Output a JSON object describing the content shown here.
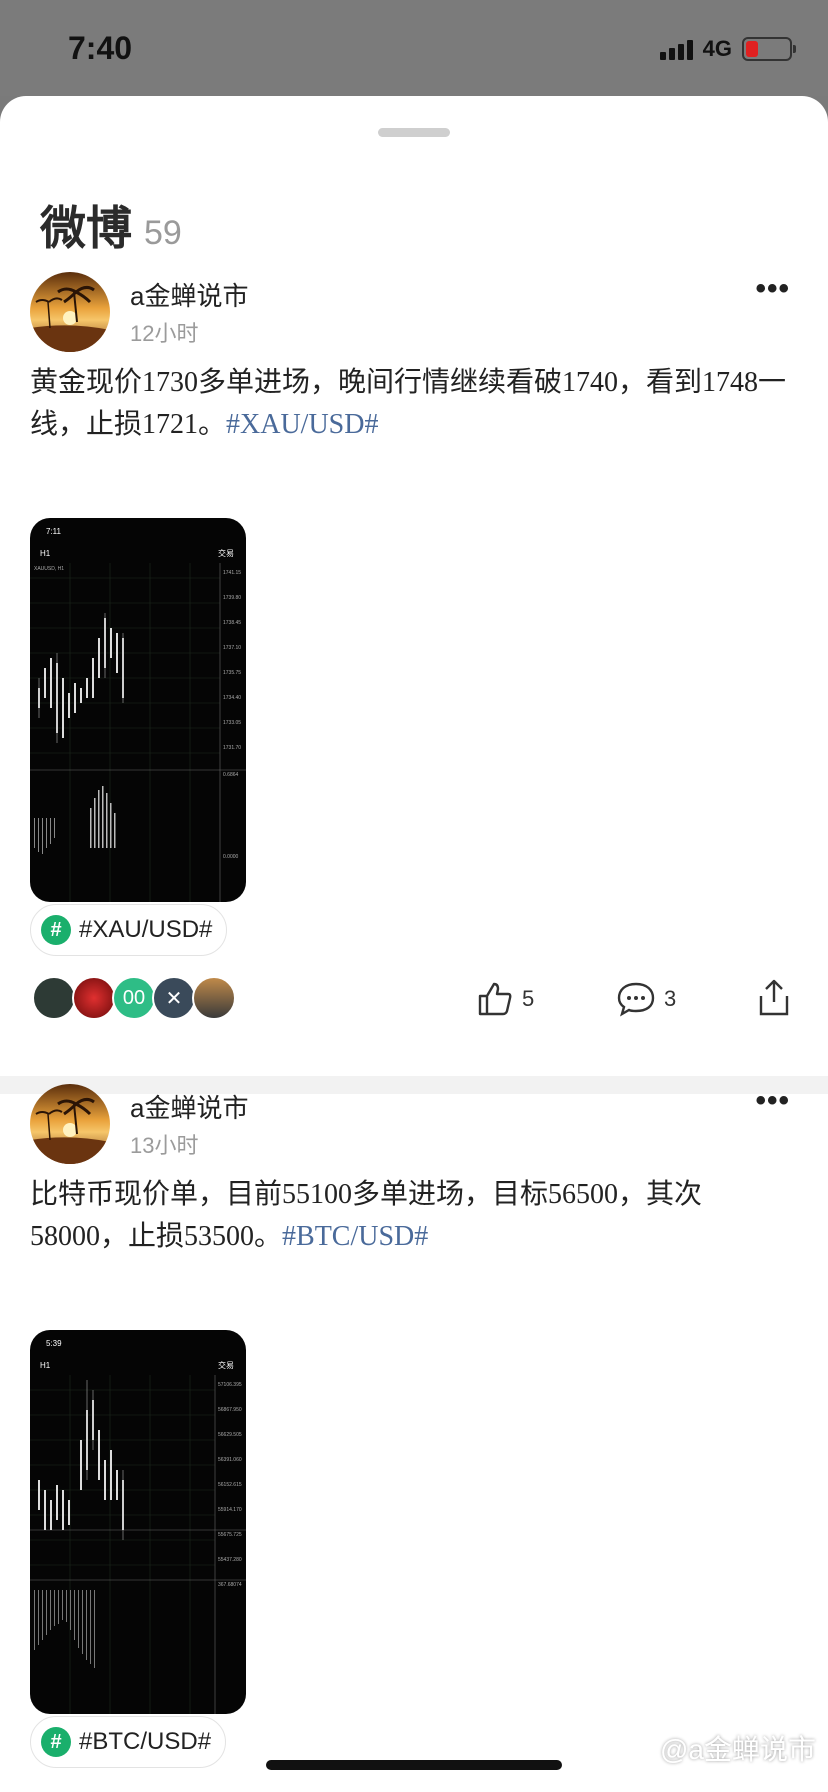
{
  "status_bar": {
    "time": "7:40",
    "network": "4G"
  },
  "sheet": {
    "title": "微博",
    "count": "59"
  },
  "posts": [
    {
      "author": "a金蝉说市",
      "time": "12小时",
      "text": "黄金现价1730多单进场，晚间行情继续看破1740，看到1748一线，止损1721。",
      "text_hashtag": "#XAU/USD#",
      "tag_chip": "#XAU/USD#",
      "likes": "5",
      "comments": "3",
      "screenshot": {
        "time": "7:11",
        "timeframe": "H1",
        "trade_label": "交易",
        "symbol": "XAUUSD, H1"
      }
    },
    {
      "author": "a金蝉说市",
      "time": "13小时",
      "text": "比特币现价单，目前55100多单进场，目标56500，其次58000，止损53500。",
      "text_hashtag": "#BTC/USD#",
      "tag_chip": "#BTC/USD#",
      "screenshot": {
        "time": "5:39",
        "timeframe": "H1",
        "trade_label": "交易"
      }
    }
  ],
  "likers_label_3": "00",
  "watermark": "@a金蝉说市",
  "icons": {
    "more": "more-icon",
    "like": "thumbs-up-icon",
    "comment": "comment-icon",
    "share": "share-icon",
    "hashtag": "hashtag-icon"
  },
  "colors": {
    "hashtag": "#4a6a9a",
    "tag_icon": "#1aaf6c",
    "battery_low": "#e02020"
  }
}
